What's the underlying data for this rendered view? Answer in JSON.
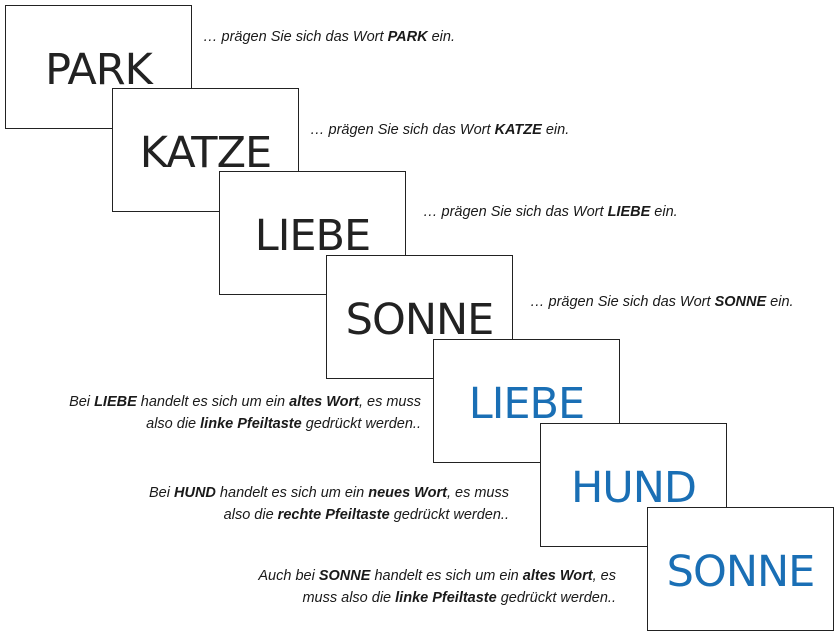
{
  "cards": [
    {
      "word": "PARK",
      "color": "#222222"
    },
    {
      "word": "KATZE",
      "color": "#222222"
    },
    {
      "word": "LIEBE",
      "color": "#222222"
    },
    {
      "word": "SONNE",
      "color": "#222222"
    },
    {
      "word": "LIEBE",
      "color": "#1a6fb5"
    },
    {
      "word": "HUND",
      "color": "#1a6fb5"
    },
    {
      "word": "SONNE",
      "color": "#1a6fb5"
    }
  ],
  "captions": [
    {
      "lines": [
        [
          {
            "t": "… prägen Sie sich das Wort "
          },
          {
            "t": "PARK",
            "b": true
          },
          {
            "t": " ein."
          }
        ]
      ]
    },
    {
      "lines": [
        [
          {
            "t": "… prägen Sie sich das Wort "
          },
          {
            "t": "KATZE",
            "b": true
          },
          {
            "t": " ein."
          }
        ]
      ]
    },
    {
      "lines": [
        [
          {
            "t": "… prägen Sie sich das Wort "
          },
          {
            "t": "LIEBE",
            "b": true
          },
          {
            "t": " ein."
          }
        ]
      ]
    },
    {
      "lines": [
        [
          {
            "t": "… prägen Sie sich das Wort "
          },
          {
            "t": "SONNE",
            "b": true
          },
          {
            "t": " ein."
          }
        ]
      ]
    },
    {
      "lines": [
        [
          {
            "t": "Bei "
          },
          {
            "t": "LIEBE",
            "b": true
          },
          {
            "t": " handelt es sich um ein "
          },
          {
            "t": "altes Wort",
            "b": true
          },
          {
            "t": ", es muss"
          }
        ],
        [
          {
            "t": "also die "
          },
          {
            "t": "linke Pfeiltaste",
            "b": true
          },
          {
            "t": " gedrückt werden.."
          }
        ]
      ]
    },
    {
      "lines": [
        [
          {
            "t": "Bei "
          },
          {
            "t": "HUND",
            "b": true
          },
          {
            "t": " handelt es sich um ein "
          },
          {
            "t": "neues Wort",
            "b": true
          },
          {
            "t": ", es muss"
          }
        ],
        [
          {
            "t": "also die "
          },
          {
            "t": "rechte Pfeiltaste",
            "b": true
          },
          {
            "t": " gedrückt werden.."
          }
        ]
      ]
    },
    {
      "lines": [
        [
          {
            "t": "Auch bei "
          },
          {
            "t": "SONNE",
            "b": true
          },
          {
            "t": " handelt es sich um ein "
          },
          {
            "t": "altes Wort",
            "b": true
          },
          {
            "t": ", es"
          }
        ],
        [
          {
            "t": "muss also die "
          },
          {
            "t": "linke Pfeiltaste",
            "b": true
          },
          {
            "t": " gedrückt werden.."
          }
        ]
      ]
    }
  ]
}
